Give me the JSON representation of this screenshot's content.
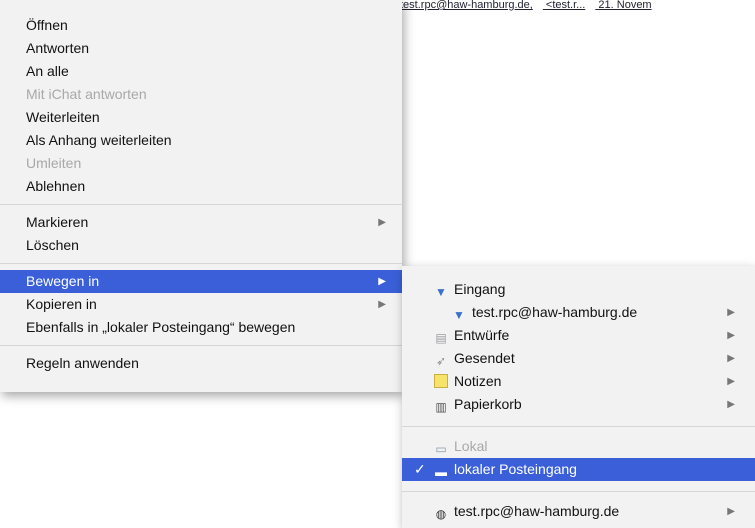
{
  "background": {
    "mail_row": [
      "test.rpc@haw-hamburg.de,",
      "<test.r...",
      "21. Novem"
    ]
  },
  "context_menu": {
    "group1": [
      {
        "label": "Öffnen",
        "disabled": false
      },
      {
        "label": "Antworten",
        "disabled": false
      },
      {
        "label": "An alle",
        "disabled": false
      },
      {
        "label": "Mit iChat antworten",
        "disabled": true
      },
      {
        "label": "Weiterleiten",
        "disabled": false
      },
      {
        "label": "Als Anhang weiterleiten",
        "disabled": false
      },
      {
        "label": "Umleiten",
        "disabled": true
      },
      {
        "label": "Ablehnen",
        "disabled": false
      }
    ],
    "group2": [
      {
        "label": "Markieren",
        "submenu": true
      },
      {
        "label": "Löschen",
        "submenu": false
      }
    ],
    "group3": [
      {
        "label": "Bewegen in",
        "submenu": true,
        "highlighted": true
      },
      {
        "label": "Kopieren in",
        "submenu": true
      },
      {
        "label": "Ebenfalls in „lokaler Posteingang“ bewegen",
        "submenu": false
      }
    ],
    "group4": [
      {
        "label": "Regeln anwenden"
      }
    ],
    "arrow_glyph": "▶"
  },
  "submenu": {
    "mailboxes": [
      {
        "label": "Eingang",
        "icon": "inbox-icon",
        "submenu": false
      },
      {
        "label": "test.rpc@haw-hamburg.de",
        "icon": "inbox-account-icon",
        "submenu": true
      },
      {
        "label": "Entwürfe",
        "icon": "drafts-icon",
        "submenu": true
      },
      {
        "label": "Gesendet",
        "icon": "sent-icon",
        "submenu": true
      },
      {
        "label": "Notizen",
        "icon": "notes-icon",
        "submenu": true
      },
      {
        "label": "Papierkorb",
        "icon": "trash-icon",
        "submenu": true
      }
    ],
    "local_header": "Lokal",
    "local_selected": "lokaler Posteingang",
    "account": "test.rpc@haw-hamburg.de",
    "check_glyph": "✓"
  },
  "colors": {
    "highlight": "#3a5fd8",
    "menu_bg": "#f2f2f2",
    "disabled_text": "#a8a8a8"
  }
}
